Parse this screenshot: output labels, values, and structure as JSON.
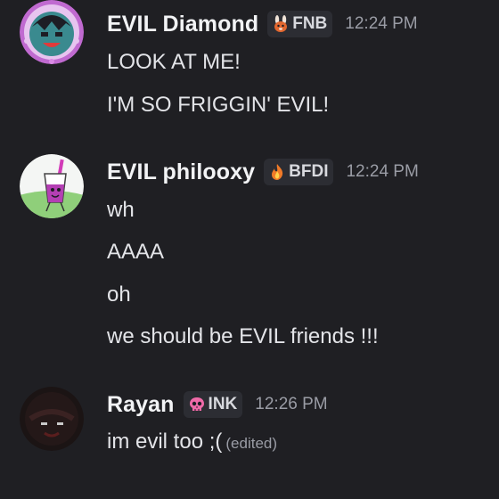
{
  "messages": [
    {
      "username": "EVIL Diamond",
      "tag": {
        "label": "FNB",
        "icon": "bunny-icon"
      },
      "time": "12:24 PM",
      "lines": [
        "LOOK AT ME!",
        "I'M SO FRIGGIN' EVIL!"
      ]
    },
    {
      "username": "EVIL philooxy",
      "tag": {
        "label": "BFDI",
        "icon": "fire-icon"
      },
      "time": "12:24 PM",
      "lines": [
        "wh",
        "AAAA",
        "oh",
        "we should be EVIL friends !!!"
      ]
    },
    {
      "username": "Rayan",
      "tag": {
        "label": "INK",
        "icon": "skull-icon"
      },
      "time": "12:26 PM",
      "lines": [
        "im evil too ;("
      ],
      "edited_label": "(edited)"
    }
  ],
  "colors": {
    "background": "#1f1f23",
    "username": "#f2f3f5",
    "timestamp": "#9a9ca5",
    "tag_background": "#2c2d33"
  }
}
